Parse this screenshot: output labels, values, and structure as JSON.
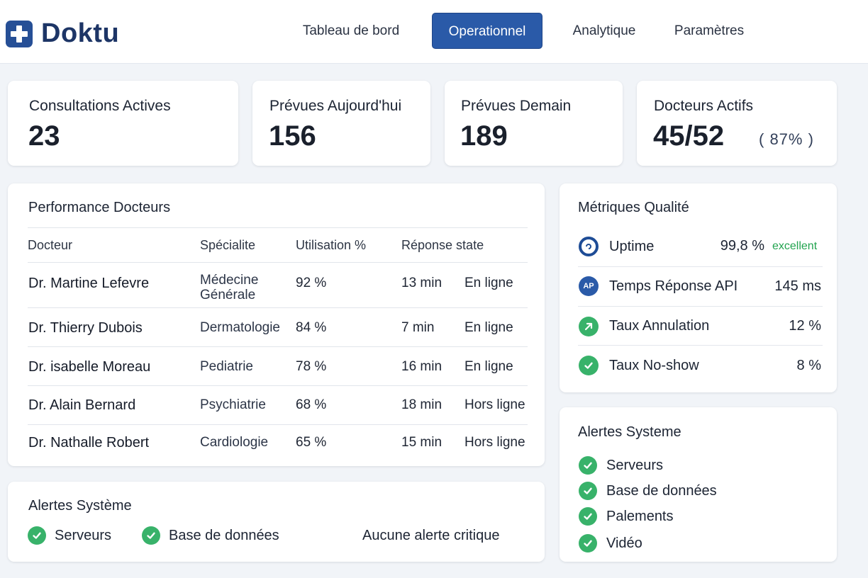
{
  "app": {
    "name": "Doktu"
  },
  "nav": {
    "items": [
      {
        "label": "Tableau de bord"
      },
      {
        "label": "Operationnel"
      },
      {
        "label": "Analytique"
      },
      {
        "label": "Paramètres"
      }
    ],
    "active_index": 1
  },
  "stats": [
    {
      "label": "Consultations Actives",
      "value": "23"
    },
    {
      "label": "Prévues Aujourd'hui",
      "value": "156"
    },
    {
      "label": "Prévues Demain",
      "value": "189"
    },
    {
      "label": "Docteurs Actifs",
      "value": "45/52",
      "sub": "( 87% )"
    }
  ],
  "doctors": {
    "title": "Performance Docteurs",
    "headers": [
      "Docteur",
      "Spécialite",
      "Utilisation %",
      "Réponse state"
    ],
    "rows": [
      {
        "name": "Dr. Martine Lefevre",
        "spec_line1": "Médecine",
        "spec_line2": "Générale",
        "util": "92 %",
        "resp": "13 min",
        "state": "En ligne"
      },
      {
        "name": "Dr. Thierry Dubois",
        "spec_line1": "Dermatologie",
        "spec_line2": "",
        "util": "84 %",
        "resp": "7 min",
        "state": "En ligne"
      },
      {
        "name": "Dr. isabelle Moreau",
        "spec_line1": "Pediatrie",
        "spec_line2": "",
        "util": "78 %",
        "resp": "16 min",
        "state": "En ligne"
      },
      {
        "name": "Dr. Alain Bernard",
        "spec_line1": "Psychiatrie",
        "spec_line2": "",
        "util": "68 %",
        "resp": "18 min",
        "state": "Hors ligne"
      },
      {
        "name": "Dr. Nathalle Robert",
        "spec_line1": "Cardiologie",
        "spec_line2": "",
        "util": "65 %",
        "resp": "15 min",
        "state": "Hors ligne"
      }
    ]
  },
  "metrics": {
    "title": "Métriques Qualité",
    "items": [
      {
        "label": "Uptime",
        "value": "99,8 %",
        "tag": "excellent",
        "icon": "uptime-icon"
      },
      {
        "label": "Temps Réponse API",
        "value": "145 ms",
        "icon": "api-icon",
        "icon_text": "AP"
      },
      {
        "label": "Taux Annulation",
        "value": "12 %",
        "icon": "arrow-up-right-icon"
      },
      {
        "label": "Taux No-show",
        "value": "8 %",
        "icon": "check-circle-icon"
      }
    ]
  },
  "alerts_right": {
    "title": "Alertes Systeme",
    "items": [
      {
        "label": "Serveurs"
      },
      {
        "label": "Base de données"
      },
      {
        "label": "Palements"
      },
      {
        "label": "Vidéo"
      }
    ]
  },
  "alerts_bottom": {
    "title": "Alertes Système",
    "items": [
      {
        "label": "Serveurs"
      },
      {
        "label": "Base de données"
      }
    ],
    "status": "Aucune alerte critique"
  },
  "colors": {
    "brand": "#264f96",
    "nav_active": "#2a5aa8",
    "ok": "#38b26a",
    "excellent": "#22a34f"
  }
}
